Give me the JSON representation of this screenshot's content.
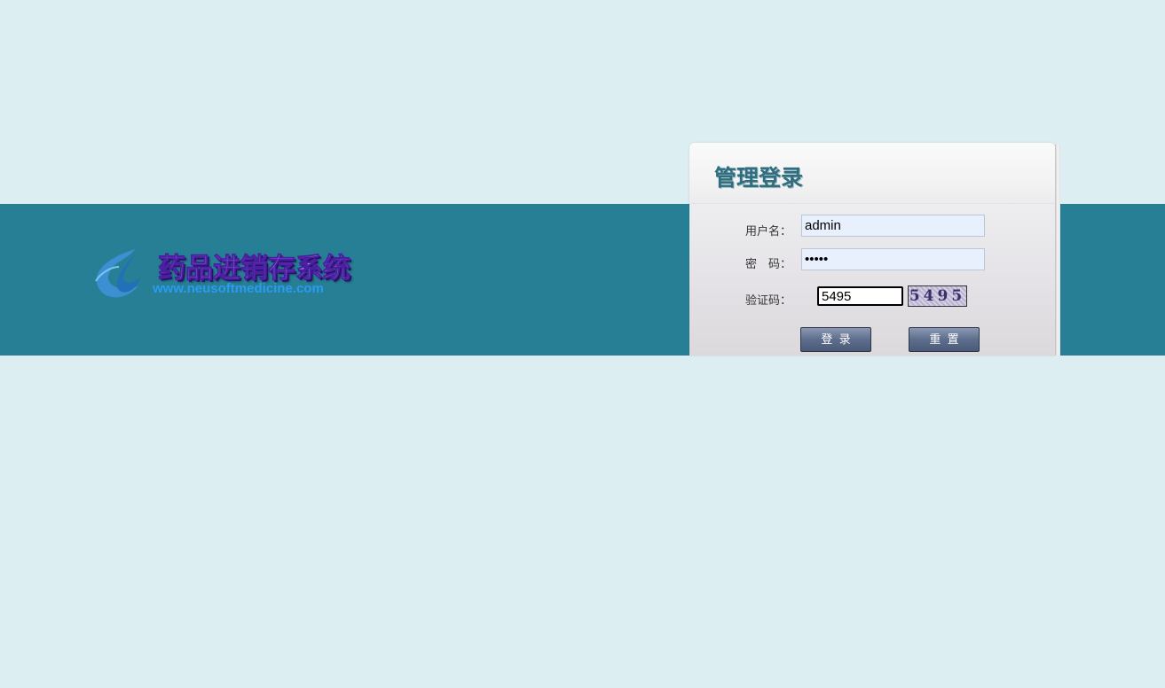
{
  "brand": {
    "title": "药品进销存系统",
    "url": "www.neusoftmedicine.com",
    "logo_icon": "butterfly-logo-icon"
  },
  "login": {
    "title": "管理登录",
    "username_label": "用户名：",
    "username_value": "admin",
    "password_label": "密　码：",
    "password_value": "•••••",
    "captcha_label": "验证码：",
    "captcha_value": "5495",
    "captcha_image_text": "5495",
    "login_button": "登  录",
    "reset_button": "重  置"
  },
  "colors": {
    "background": "#ddeef2",
    "band": "#267f95",
    "button": "#5d6d8c",
    "title": "#2f6e7e"
  }
}
